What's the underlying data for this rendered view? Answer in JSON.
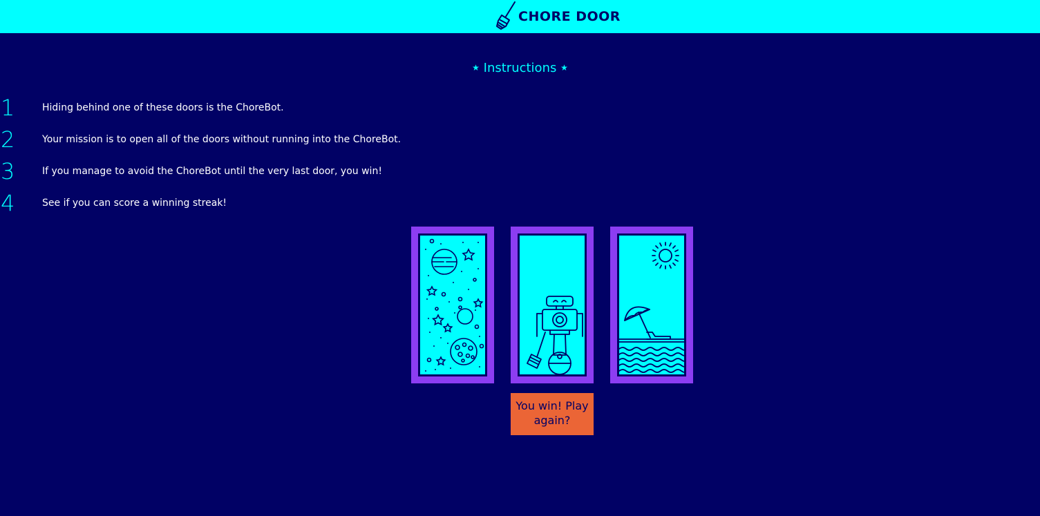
{
  "header": {
    "title": "CHORE DOOR",
    "icon": "broom-icon",
    "background_color": "#00ffff"
  },
  "instructions": {
    "title": "Instructions",
    "star_glyph": "★",
    "steps": [
      {
        "number": "1",
        "text": "Hiding behind one of these doors is the ChoreBot."
      },
      {
        "number": "2",
        "text": "Your mission is to open all of the doors without running into the ChoreBot."
      },
      {
        "number": "3",
        "text": "If you manage to avoid the ChoreBot until the very last door, you win!"
      },
      {
        "number": "4",
        "text": "See if you can score a winning streak!"
      }
    ]
  },
  "doors": [
    {
      "content": "space",
      "icon": "space-scene-icon"
    },
    {
      "content": "chorebot",
      "icon": "robot-icon"
    },
    {
      "content": "beach",
      "icon": "beach-scene-icon"
    }
  ],
  "start_button": {
    "label": "You win! Play again?",
    "color": "#eb6536"
  },
  "colors": {
    "page_background": "#010165",
    "accent": "#00ffff",
    "door_frame": "#8c3df2",
    "text": "#ffffff"
  }
}
